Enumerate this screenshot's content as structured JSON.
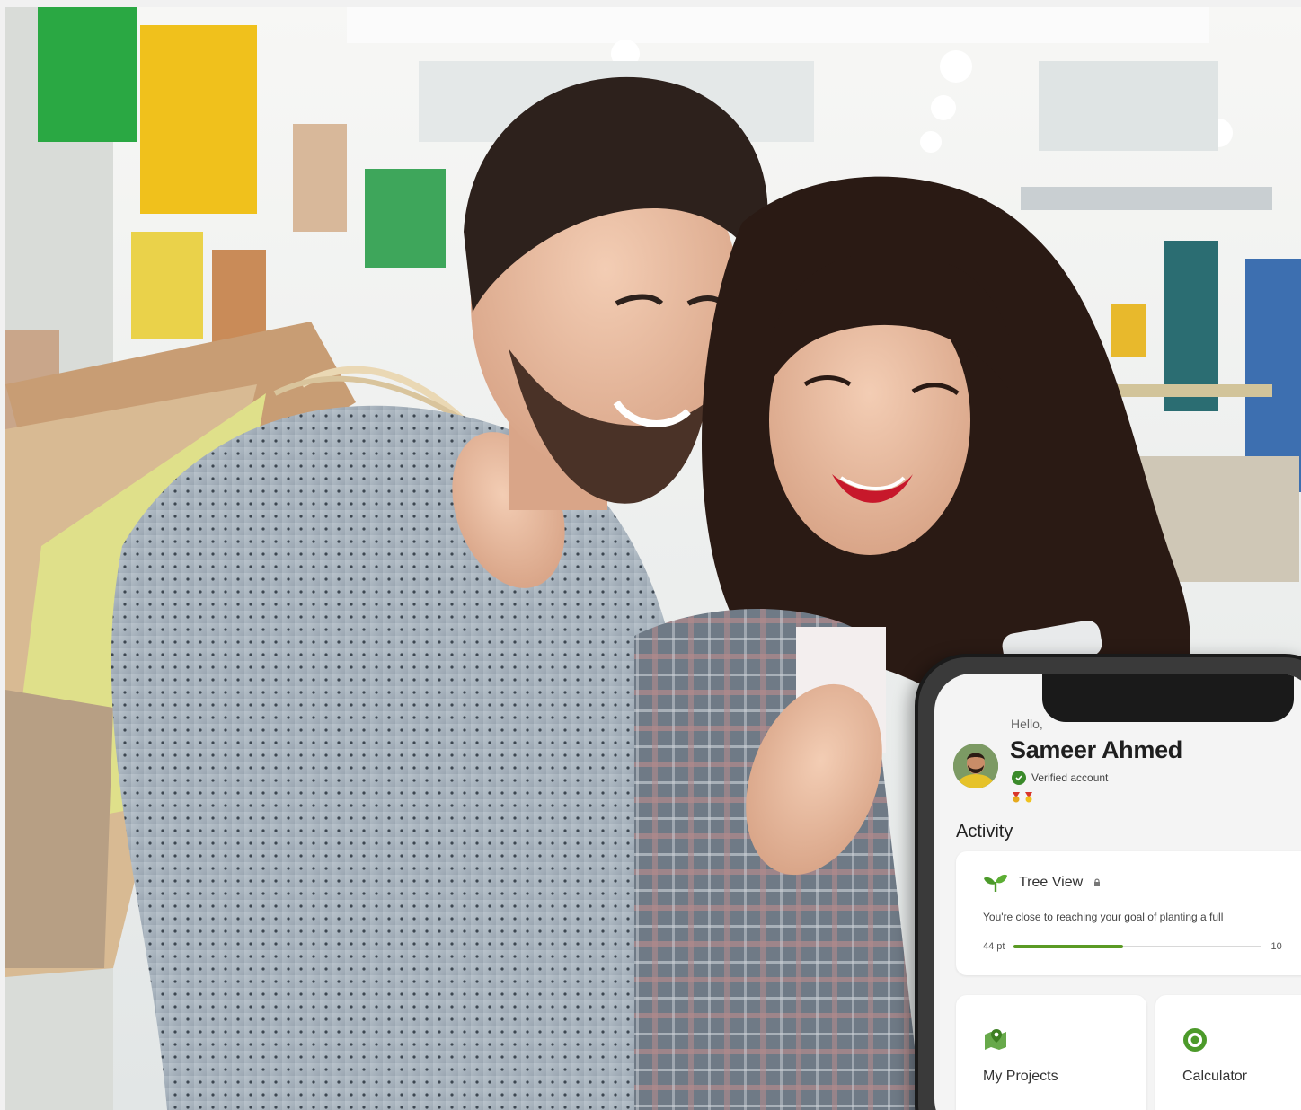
{
  "app": {
    "greeting": "Hello,",
    "user_name": "Sameer Ahmed",
    "verified_label": "Verified account",
    "activity_title": "Activity",
    "tree_view": {
      "title": "Tree View",
      "message": "You're close to reaching your goal of planting a full",
      "points_label": "44 pt",
      "max_label": "10",
      "progress": 0.44
    },
    "tiles": [
      {
        "label": "My Projects",
        "icon": "map-pin-icon"
      },
      {
        "label": "Calculator",
        "icon": "target-icon"
      }
    ]
  },
  "colors": {
    "accent_green": "#5a9a24",
    "verified_green": "#3a8a2a",
    "phone_frame": "#1a1a1a"
  }
}
